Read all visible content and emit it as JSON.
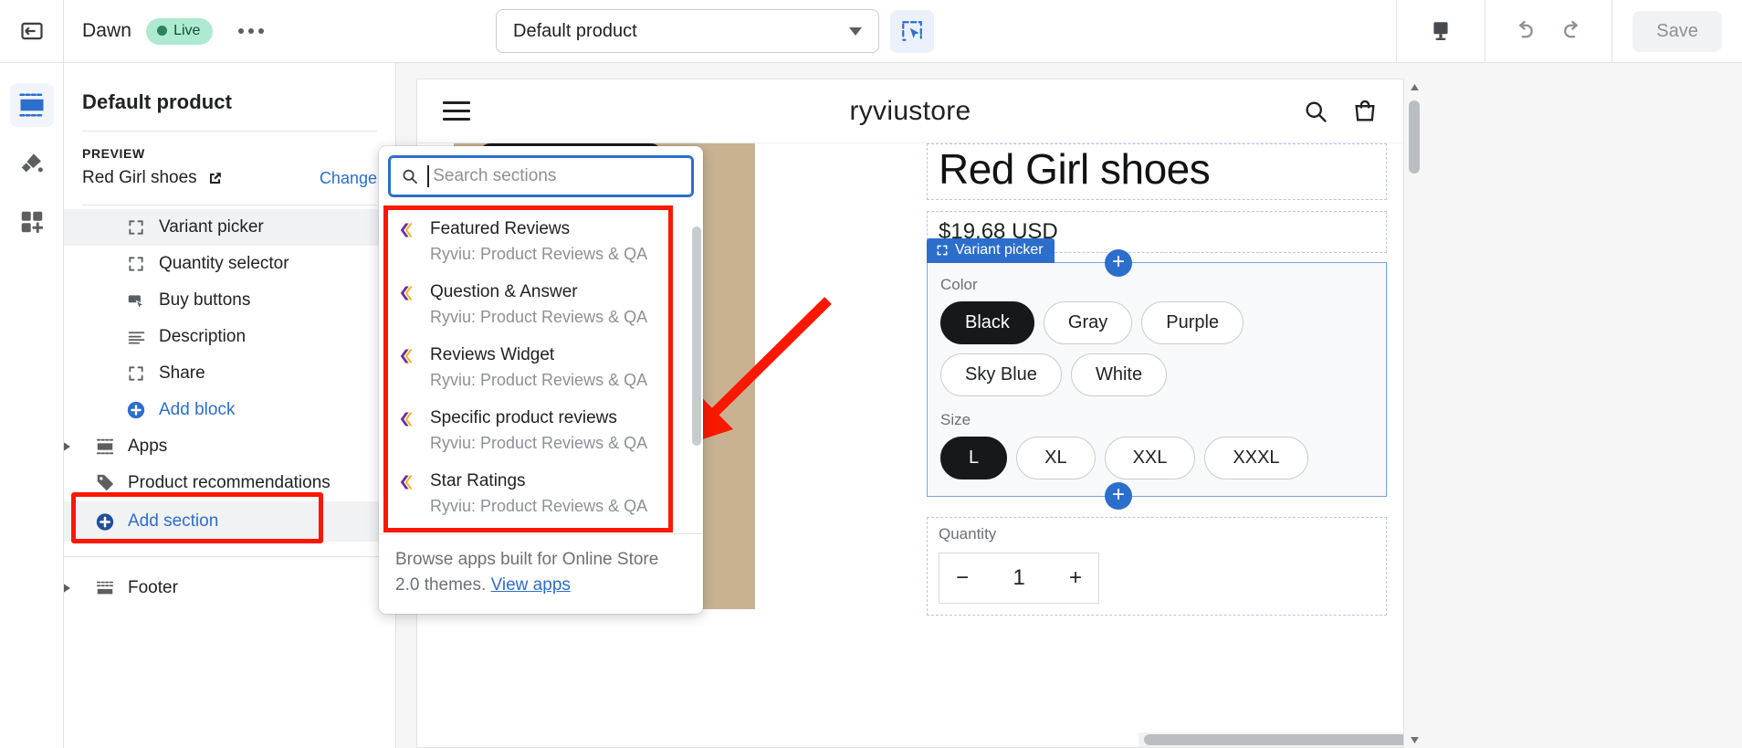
{
  "topbar": {
    "exit_icon": "exit-icon",
    "theme_name": "Dawn",
    "live_label": "Live",
    "more_icon": "more-options-icon",
    "page_selector_value": "Default product",
    "inspector_icon": "section-inspector-icon",
    "device_icon": "desktop-preview-icon",
    "undo_icon": "undo-icon",
    "redo_icon": "redo-icon",
    "save_label": "Save"
  },
  "rail": {
    "items": [
      {
        "name": "sections-icon",
        "label": "Sections"
      },
      {
        "name": "paintbrush-icon",
        "label": "Theme settings"
      },
      {
        "name": "apps-icon",
        "label": "App embeds"
      }
    ]
  },
  "sidebar": {
    "title": "Default product",
    "preview_label": "PREVIEW",
    "preview_product": "Red Girl shoes",
    "change_label": "Change",
    "blocks": [
      {
        "label": "Variant picker",
        "icon": "placeholder-block-icon",
        "selected": true
      },
      {
        "label": "Quantity selector",
        "icon": "placeholder-block-icon",
        "selected": false
      },
      {
        "label": "Buy buttons",
        "icon": "buy-button-icon",
        "selected": false
      },
      {
        "label": "Description",
        "icon": "text-lines-icon",
        "selected": false
      },
      {
        "label": "Share",
        "icon": "placeholder-block-icon",
        "selected": false
      }
    ],
    "add_block_label": "Add block",
    "apps_label": "Apps",
    "product_recommendations_label": "Product recommendations",
    "add_section_label": "Add section",
    "footer_label": "Footer"
  },
  "popover": {
    "search_placeholder": "Search sections",
    "search_value": "",
    "items": [
      {
        "title": "Featured Reviews",
        "subtitle": "Ryviu: Product Reviews & QA"
      },
      {
        "title": "Question & Answer",
        "subtitle": "Ryviu: Product Reviews & QA"
      },
      {
        "title": "Reviews Widget",
        "subtitle": "Ryviu: Product Reviews & QA"
      },
      {
        "title": "Specific product reviews",
        "subtitle": "Ryviu: Product Reviews & QA"
      },
      {
        "title": "Star Ratings",
        "subtitle": "Ryviu: Product Reviews & QA"
      }
    ],
    "footer_text": "Browse apps built for Online Store 2.0 themes.",
    "footer_link": "View apps"
  },
  "preview": {
    "store_name": "ryviustore",
    "menu_icon": "hamburger-menu-icon",
    "search_icon": "search-icon",
    "cart_icon": "cart-icon",
    "product_title": "Red Girl shoes",
    "product_price": "$19.68 USD",
    "variant_tag": "Variant picker",
    "color_label": "Color",
    "colors": [
      {
        "label": "Black",
        "selected": true
      },
      {
        "label": "Gray",
        "selected": false
      },
      {
        "label": "Purple",
        "selected": false
      },
      {
        "label": "Sky Blue",
        "selected": false
      },
      {
        "label": "White",
        "selected": false
      }
    ],
    "size_label": "Size",
    "sizes": [
      {
        "label": "L",
        "selected": true
      },
      {
        "label": "XL",
        "selected": false
      },
      {
        "label": "XXL",
        "selected": false
      },
      {
        "label": "XXXL",
        "selected": false
      }
    ],
    "quantity_label": "Quantity",
    "quantity_value": "1",
    "quantity_minus": "−",
    "quantity_plus": "+",
    "add_block_plus": "+"
  },
  "colors": {
    "accent_blue": "#2c6ecb",
    "annotation_red": "#fb1800",
    "live_green_bg": "#aee9d1",
    "live_green_text": "#0c5132",
    "ryviu_purple": "#6b2fa0",
    "ryviu_yellow": "#f4b41a"
  }
}
